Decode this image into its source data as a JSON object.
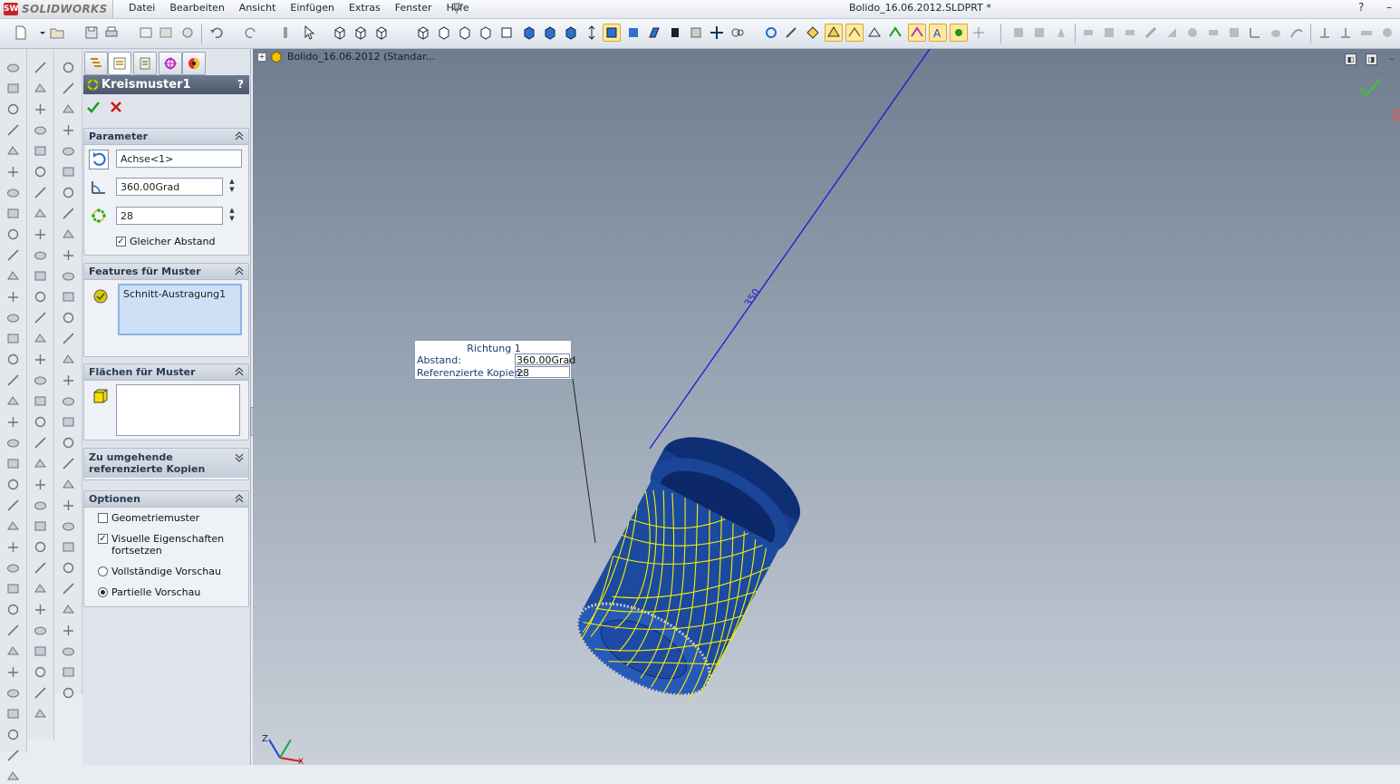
{
  "app": {
    "logo_text": "SOLIDWORKS",
    "logo_mark": "SW",
    "menu": [
      "Datei",
      "Bearbeiten",
      "Ansicht",
      "Einfügen",
      "Extras",
      "Fenster",
      "Hilfe"
    ],
    "document_title": "Bolido_16.06.2012.SLDPRT *",
    "help_icon": "?",
    "minimize_icon": "–"
  },
  "property_manager": {
    "title": "Kreismuster1",
    "help": "?",
    "parameter": {
      "header": "Parameter",
      "axis_value": "Achse<1>",
      "angle_value": "360.00Grad",
      "instances_value": "28",
      "equal_spacing_label": "Gleicher Abstand",
      "equal_spacing_checked": true
    },
    "features": {
      "header": "Features für Muster",
      "items": [
        "Schnitt-Austragung1"
      ]
    },
    "faces": {
      "header": "Flächen für Muster",
      "items": []
    },
    "skip": {
      "header_line1": "Zu umgehende",
      "header_line2": "referenzierte Kopien"
    },
    "options": {
      "header": "Optionen",
      "geometry_pattern_label": "Geometriemuster",
      "geometry_pattern_checked": false,
      "propagate_visual_line1": "Visuelle Eigenschaften",
      "propagate_visual_line2": "fortsetzen",
      "propagate_visual_checked": true,
      "full_preview_label": "Vollständige Vorschau",
      "partial_preview_label": "Partielle Vorschau",
      "preview_mode": "partial"
    }
  },
  "viewport": {
    "tree_label": "Bolido_16.06.2012  (Standar...",
    "dimension_label": "350",
    "callout": {
      "title": "Richtung 1",
      "row1_label": "Abstand:",
      "row1_value": "360.00Grad",
      "row2_label": "Referenzierte Kopien:",
      "row2_value": "28"
    },
    "triad_z": "Z",
    "triad_x": "X",
    "colors": {
      "model_blue": "#1f3f8f",
      "preview_yellow": "#f5f000",
      "axis_blue": "#1a1ad0"
    }
  }
}
